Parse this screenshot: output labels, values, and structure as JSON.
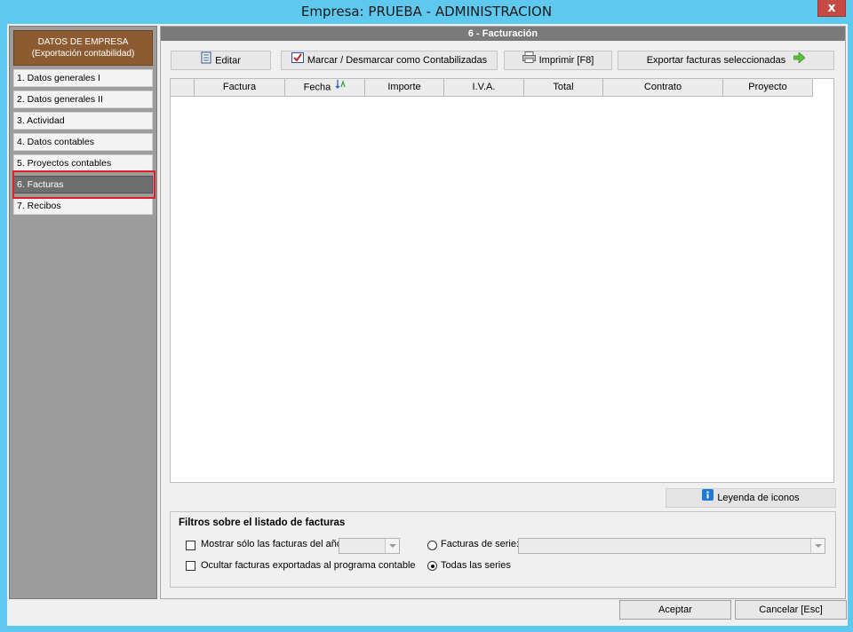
{
  "window": {
    "title": "Empresa: PRUEBA - ADMINISTRACION",
    "close_label": "x"
  },
  "sidebar": {
    "header_line1": "DATOS DE EMPRESA",
    "header_line2": "(Exportación contabilidad)",
    "items": [
      {
        "label": "1. Datos generales I"
      },
      {
        "label": "2. Datos generales II"
      },
      {
        "label": "3. Actividad"
      },
      {
        "label": "4. Datos contables"
      },
      {
        "label": "5. Proyectos contables"
      },
      {
        "label": "6. Facturas"
      },
      {
        "label": "7. Recibos"
      }
    ],
    "active_index": 5
  },
  "main": {
    "section_title": "6 - Facturación",
    "toolbar": {
      "edit_label": "Editar",
      "mark_label": "Marcar / Desmarcar como Contabilizadas",
      "print_label": "Imprimir [F8]",
      "export_label": "Exportar facturas seleccionadas"
    },
    "grid": {
      "columns": [
        "",
        "Factura",
        "Fecha",
        "Importe",
        "I.V.A.",
        "Total",
        "Contrato",
        "Proyecto"
      ],
      "rows": []
    },
    "legend_label": "Leyenda de iconos"
  },
  "filters": {
    "title": "Filtros sobre el listado de facturas",
    "only_year_label": "Mostrar sólo las facturas del año:",
    "only_year_checked": false,
    "year_value": "",
    "hide_exported_label": "Ocultar facturas exportadas al programa contable",
    "hide_exported_checked": false,
    "series_label": "Facturas de serie:",
    "series_value": "",
    "all_series_label": "Todas las series",
    "selected_series_option": "all"
  },
  "footer": {
    "accept_label": "Aceptar",
    "cancel_label": "Cancelar  [Esc]"
  },
  "colors": {
    "window_frame": "#5ec8ee",
    "sidebar_header": "#8c5b31",
    "active_item": "#6e6e6e",
    "highlight": "#e0202a",
    "section_header": "#7a7a7a"
  }
}
